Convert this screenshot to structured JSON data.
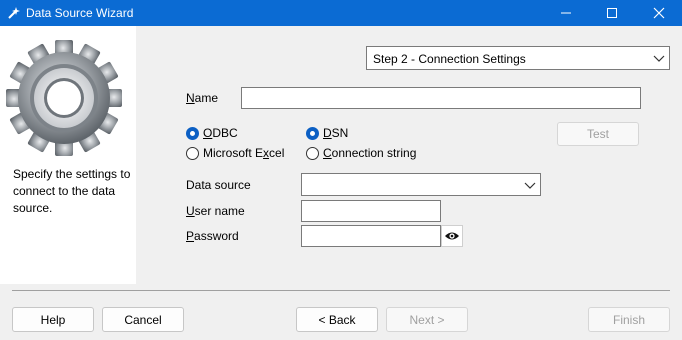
{
  "window": {
    "title": "Data Source Wizard"
  },
  "left_panel": {
    "description": "Specify the settings to connect to the data source."
  },
  "step_select": {
    "value": "Step 2 - Connection Settings"
  },
  "form": {
    "name_label_ul": "N",
    "name_label_rest": "ame",
    "name_value": "",
    "radios": {
      "odbc_ul": "O",
      "odbc_rest": "DBC",
      "odbc_checked": true,
      "excel_pre": "Microsoft E",
      "excel_ul": "x",
      "excel_rest": "cel",
      "excel_checked": false,
      "dsn_ul": "D",
      "dsn_rest": "SN",
      "dsn_checked": true,
      "conn_ul": "C",
      "conn_rest": "onnection string",
      "conn_checked": false
    },
    "test_button": "Test",
    "data_source_label": "Data source",
    "data_source_value": "",
    "user_label_ul": "U",
    "user_label_rest": "ser name",
    "user_value": "",
    "password_label_ul": "P",
    "password_label_rest": "assword",
    "password_value": ""
  },
  "footer": {
    "help": "Help",
    "cancel": "Cancel",
    "back": "< Back",
    "next": "Next >",
    "finish": "Finish"
  },
  "colors": {
    "titlebar": "#0b6bd3",
    "radio_checked": "#0b5fc4"
  }
}
